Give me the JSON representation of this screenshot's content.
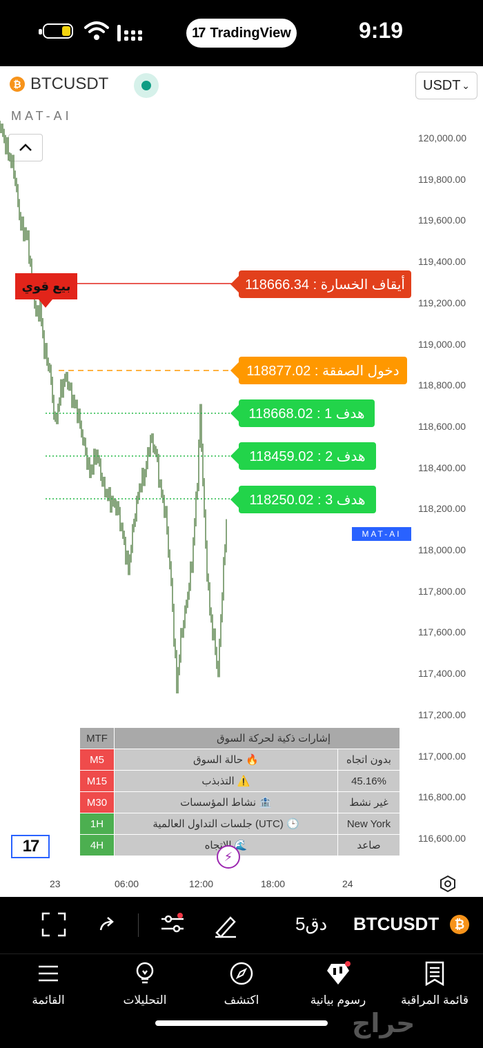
{
  "status_bar": {
    "time": "9:19",
    "app_pill": "TradingView"
  },
  "header": {
    "symbol": "BTCUSDT",
    "currency_select": "USDT",
    "indicator_name": "MAT-AI"
  },
  "price_axis": [
    "120,000.00",
    "119,800.00",
    "119,600.00",
    "119,400.00",
    "119,200.00",
    "119,000.00",
    "118,800.00",
    "118,600.00",
    "118,400.00",
    "118,200.00",
    "118,000.00",
    "117,800.00",
    "117,600.00",
    "117,400.00",
    "117,200.00",
    "117,000.00",
    "116,800.00",
    "116,600.00"
  ],
  "time_axis": [
    "23",
    "06:00",
    "12:00",
    "18:00",
    "24"
  ],
  "signal": {
    "sell_label": "بيع قوي",
    "stop_loss": "أيقاف الخسارة : 118666.34",
    "entry": "دخول الصفقة : 118877.02",
    "target1": "هدف 1 : 118668.02",
    "target2": "هدف 2 : 118459.02",
    "target3": "هدف 3 : 118250.02",
    "indicator_tag": "MAT-AI"
  },
  "colors": {
    "stop": "#e2401c",
    "entry": "#ff9800",
    "target": "#22d44a",
    "candle": "#6b8f5e"
  },
  "mtf_table": {
    "header_tf": "MTF",
    "header_title": "إشارات ذكية لحركة السوق",
    "rows": [
      {
        "tf": "M5",
        "label": "حالة السوق",
        "icon": "🔥",
        "value": "بدون اتجاه",
        "tf_color": "red"
      },
      {
        "tf": "M15",
        "label": "التذبذب",
        "icon": "⚠️",
        "value": "45.16%",
        "tf_color": "red"
      },
      {
        "tf": "M30",
        "label": "نشاط المؤسسات",
        "icon": "🏦",
        "value": "غير نشط",
        "tf_color": "red"
      },
      {
        "tf": "1H",
        "label": "جلسات التداول العالمية (UTC)",
        "icon": "🕒",
        "value": "New York",
        "tf_color": "green"
      },
      {
        "tf": "4H",
        "label": "الاتجاه",
        "icon": "🌊",
        "value": "صاعد",
        "tf_color": "green"
      }
    ]
  },
  "toolbar": {
    "symbol": "BTCUSDT",
    "interval": "5دق"
  },
  "nav": [
    {
      "label": "القائمة",
      "icon": "menu-icon"
    },
    {
      "label": "التحليلات",
      "icon": "lightbulb-icon"
    },
    {
      "label": "اكتشف",
      "icon": "compass-icon"
    },
    {
      "label": "رسوم بيانية",
      "icon": "candles-icon"
    },
    {
      "label": "قائمة المراقبة",
      "icon": "watchlist-icon"
    }
  ],
  "watermark": "حراج"
}
